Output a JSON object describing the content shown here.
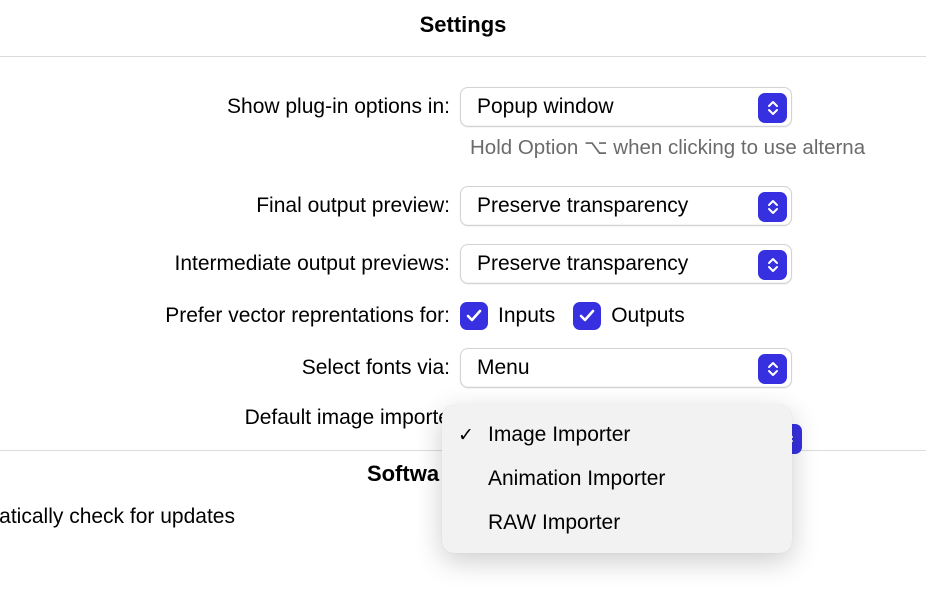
{
  "header": {
    "title": "Settings"
  },
  "plugin": {
    "label": "Show plug-in options in:",
    "value": "Popup window",
    "hint": "Hold Option ⌥ when clicking to use alterna"
  },
  "finalPreview": {
    "label": "Final output preview:",
    "value": "Preserve transparency"
  },
  "intermediatePreview": {
    "label": "Intermediate output previews:",
    "value": "Preserve transparency"
  },
  "vector": {
    "label": "Prefer vector reprentations for:",
    "inputsLabel": "Inputs",
    "outputsLabel": "Outputs",
    "inputsChecked": true,
    "outputsChecked": true
  },
  "fonts": {
    "label": "Select fonts via:",
    "value": "Menu"
  },
  "importer": {
    "label": "Default image importe",
    "menu": {
      "items": [
        {
          "label": "Image Importer",
          "checked": true
        },
        {
          "label": "Animation Importer",
          "checked": false
        },
        {
          "label": "RAW Importer",
          "checked": false
        }
      ]
    }
  },
  "software": {
    "title": "Softwa",
    "updateLabel": "omatically check for updates"
  }
}
